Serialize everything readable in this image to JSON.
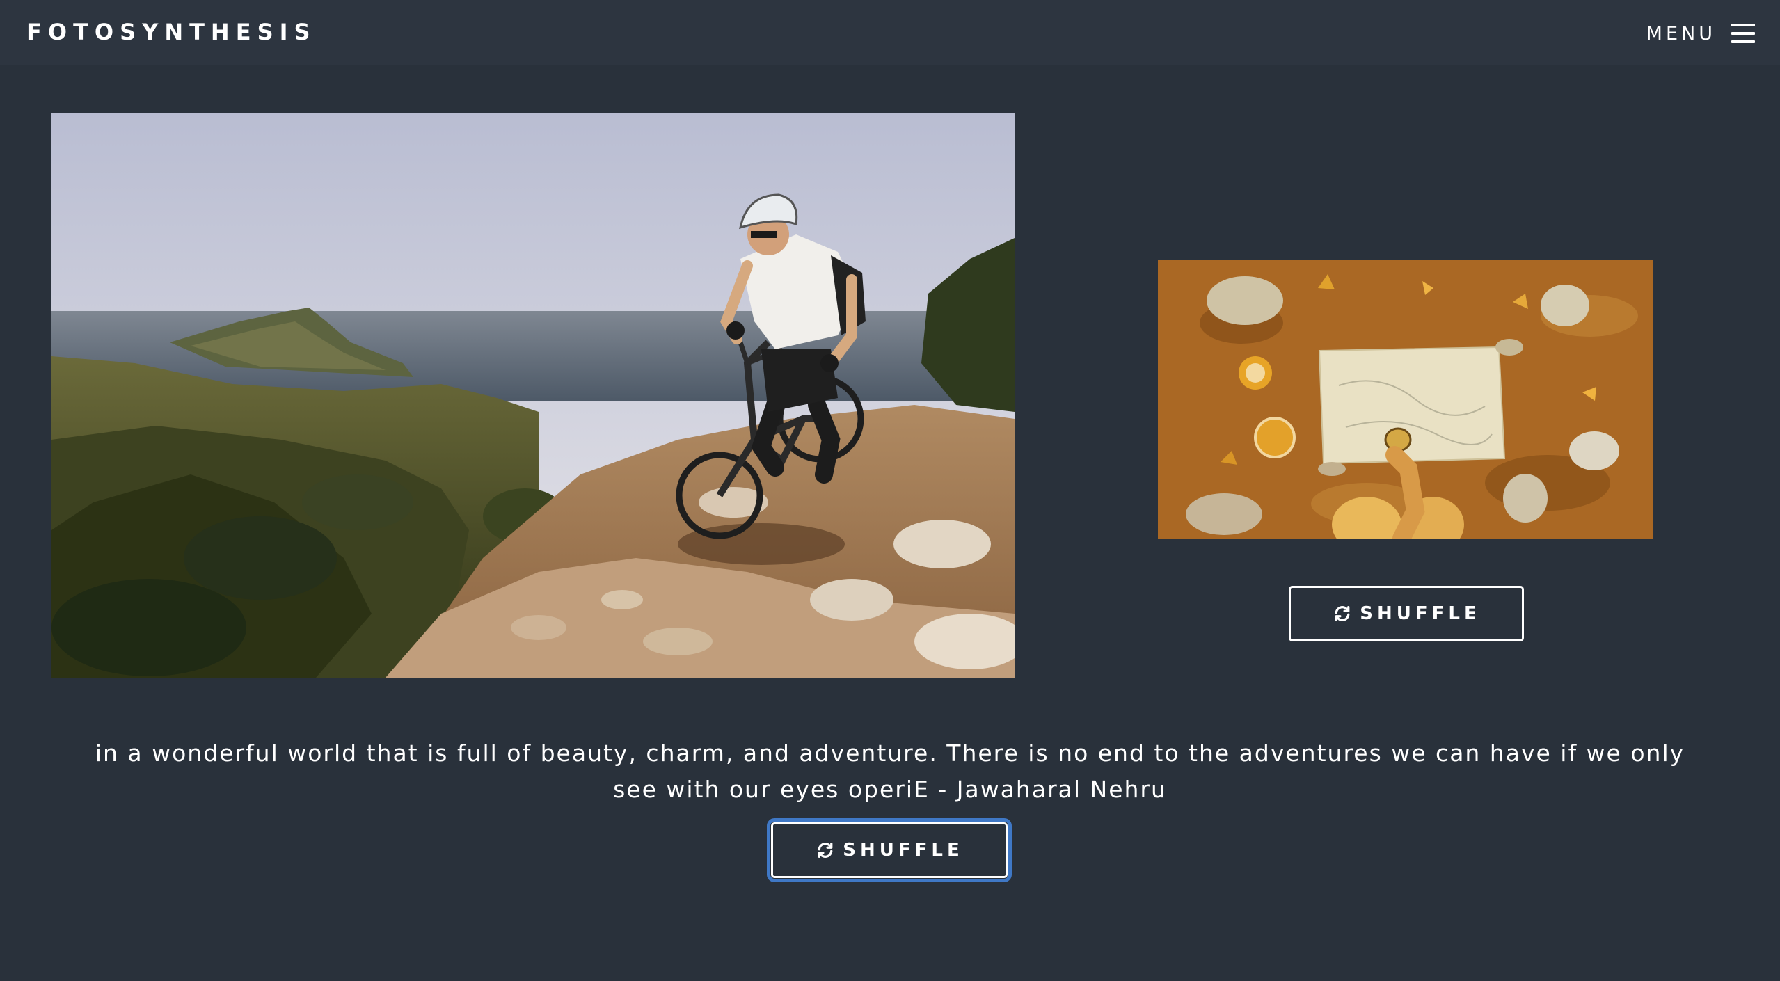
{
  "header": {
    "brand": "FOTOSYNTHESIS",
    "menu_label": "MENU",
    "menu_icon": "hamburger-icon"
  },
  "gallery": {
    "main_photo": {
      "subject": "mountain biker descending rocky coastal trail"
    },
    "side_photo": {
      "subject": "map with compass surrounded by stones"
    },
    "side_shuffle_label": "SHUFFLE",
    "shuffle_icon": "refresh-icon"
  },
  "quote": {
    "text": "in a wonderful world that is full of beauty, charm, and adventure. There is no end to the adventures we can have if we only see with our eyes operiE - Jawaharal Nehru"
  },
  "main_shuffle_label": "SHUFFLE",
  "colors": {
    "background": "#29313b",
    "topbar": "#2d3540",
    "focus_ring": "#3f78c6",
    "text": "#ffffff"
  }
}
